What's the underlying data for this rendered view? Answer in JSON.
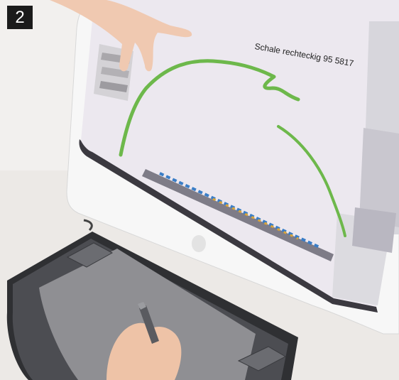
{
  "badge": {
    "number": "2"
  },
  "monitor": {
    "screen_label": "Schale rechteckig 95 5817",
    "stroke_color": "#6db84b"
  }
}
